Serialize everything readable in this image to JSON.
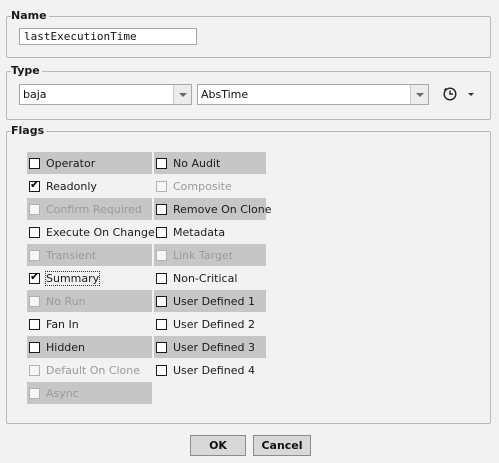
{
  "name_group": {
    "title": "Name",
    "value": "lastExecutionTime"
  },
  "type_group": {
    "title": "Type",
    "module": "baja",
    "type": "AbsTime",
    "clock_icon": "clock-icon"
  },
  "flags_group": {
    "title": "Flags",
    "left": [
      {
        "label": "Operator",
        "checked": false,
        "disabled": false,
        "shaded": true
      },
      {
        "label": "Readonly",
        "checked": true,
        "disabled": false,
        "shaded": false
      },
      {
        "label": "Confirm Required",
        "checked": false,
        "disabled": true,
        "shaded": true
      },
      {
        "label": "Execute On Change",
        "checked": false,
        "disabled": false,
        "shaded": false
      },
      {
        "label": "Transient",
        "checked": false,
        "disabled": true,
        "shaded": true
      },
      {
        "label": "Summary",
        "checked": true,
        "disabled": false,
        "shaded": false,
        "focused": true
      },
      {
        "label": "No Run",
        "checked": false,
        "disabled": true,
        "shaded": true
      },
      {
        "label": "Fan In",
        "checked": false,
        "disabled": false,
        "shaded": false
      },
      {
        "label": "Hidden",
        "checked": false,
        "disabled": false,
        "shaded": true
      },
      {
        "label": "Default On Clone",
        "checked": false,
        "disabled": true,
        "shaded": false
      },
      {
        "label": "Async",
        "checked": false,
        "disabled": true,
        "shaded": true
      }
    ],
    "right": [
      {
        "label": "No Audit",
        "checked": false,
        "disabled": false,
        "shaded": true
      },
      {
        "label": "Composite",
        "checked": false,
        "disabled": true,
        "shaded": false
      },
      {
        "label": "Remove On Clone",
        "checked": false,
        "disabled": false,
        "shaded": true
      },
      {
        "label": "Metadata",
        "checked": false,
        "disabled": false,
        "shaded": false
      },
      {
        "label": "Link Target",
        "checked": false,
        "disabled": true,
        "shaded": true
      },
      {
        "label": "Non-Critical",
        "checked": false,
        "disabled": false,
        "shaded": false
      },
      {
        "label": "User Defined 1",
        "checked": false,
        "disabled": false,
        "shaded": true
      },
      {
        "label": "User Defined 2",
        "checked": false,
        "disabled": false,
        "shaded": false
      },
      {
        "label": "User Defined 3",
        "checked": false,
        "disabled": false,
        "shaded": true
      },
      {
        "label": "User Defined 4",
        "checked": false,
        "disabled": false,
        "shaded": false
      }
    ]
  },
  "buttons": {
    "ok": "OK",
    "cancel": "Cancel"
  }
}
